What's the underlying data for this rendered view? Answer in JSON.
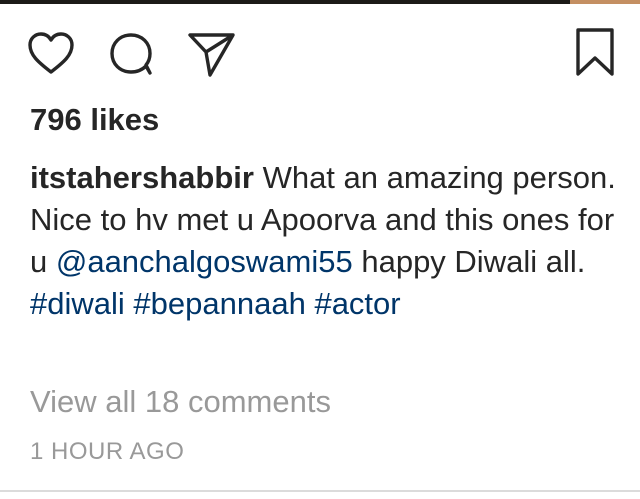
{
  "post": {
    "likes_text": "796 likes",
    "caption": {
      "username": "itstahershabbir",
      "text_part1": " What an amazing person. Nice to hv met u Apoorva and this ones for u ",
      "mention": "@aanchalgoswami55",
      "text_part2": " happy Diwali all. ",
      "hashtags": [
        "#diwali",
        "#bepannaah",
        "#actor"
      ]
    },
    "view_comments_label": "View all 18 comments",
    "timestamp": "1 HOUR AGO"
  },
  "icons": {
    "like": "heart-icon",
    "comment": "comment-icon",
    "share": "paper-plane-icon",
    "save": "bookmark-icon"
  },
  "colors": {
    "text": "#262626",
    "link": "#003569",
    "muted": "#999999"
  }
}
